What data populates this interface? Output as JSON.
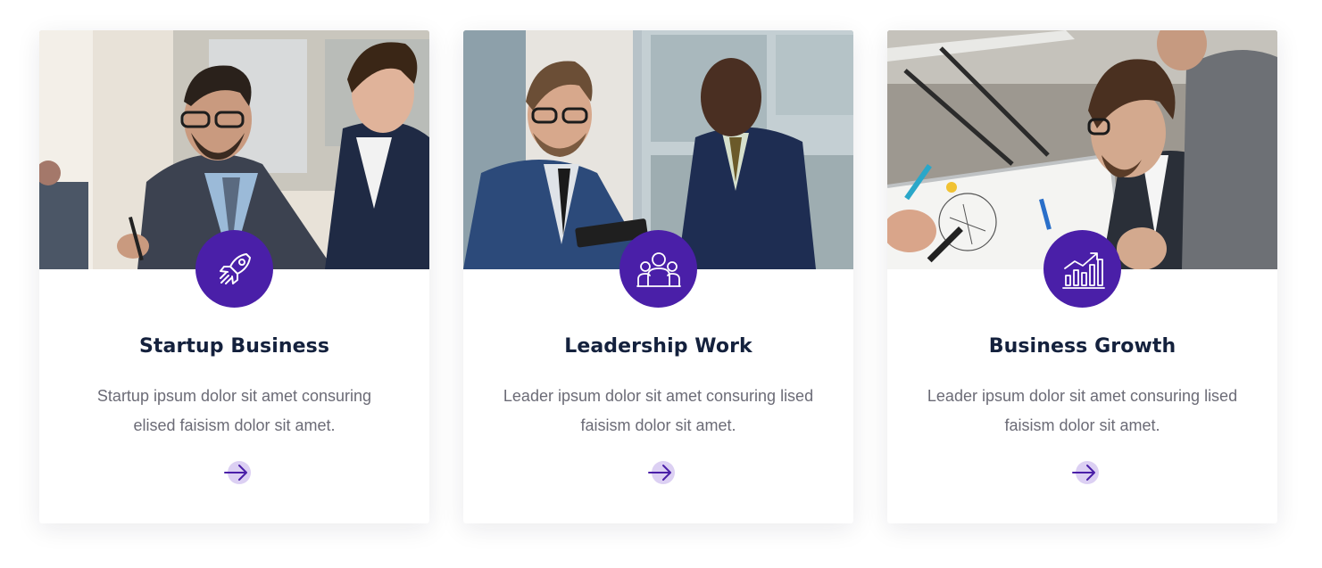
{
  "colors": {
    "accent": "#4a1fa8",
    "title": "#14213d",
    "text": "#6b6b76",
    "arrow_circle": "#dcd0f3"
  },
  "cards": [
    {
      "image": "two-businessmen-with-tablet-photo",
      "icon": "rocket-icon",
      "title": "Startup Business",
      "description": "Startup ipsum dolor sit amet consuring elised faisism dolor sit amet.",
      "link_icon": "arrow-right-icon"
    },
    {
      "image": "businessmen-discussing-tablet-photo",
      "icon": "team-icon",
      "title": "Leadership Work",
      "description": "Leader ipsum dolor sit amet consuring lised faisism dolor sit amet.",
      "link_icon": "arrow-right-icon"
    },
    {
      "image": "team-whiteboard-meeting-photo",
      "icon": "growth-chart-icon",
      "title": "Business Growth",
      "description": "Leader ipsum dolor sit amet consuring lised faisism dolor sit amet.",
      "link_icon": "arrow-right-icon"
    }
  ]
}
